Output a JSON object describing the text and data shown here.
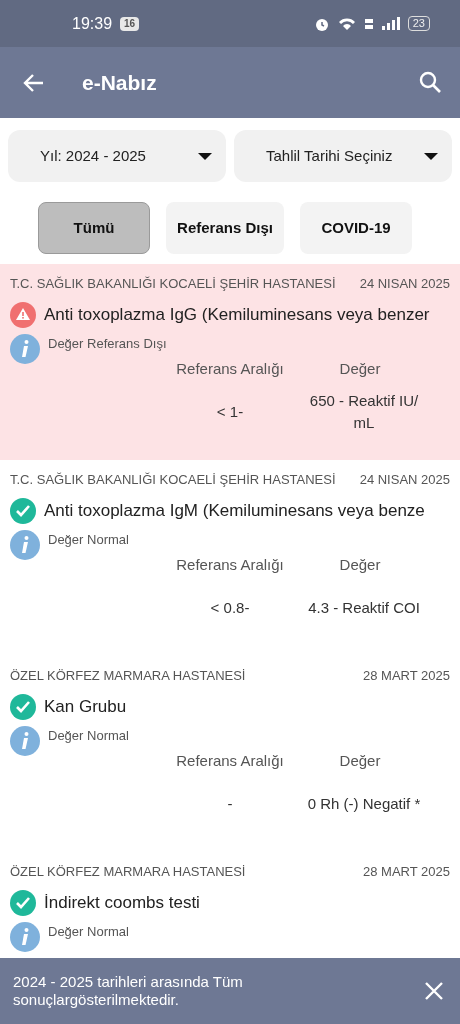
{
  "status_bar": {
    "time": "19:39",
    "notification_badge": "16",
    "battery": "23"
  },
  "app_bar": {
    "title": "e-Nabız"
  },
  "filters": [
    {
      "label": "Yıl: 2024 - 2025"
    },
    {
      "label": "Tahlil Tarihi Seçiniz"
    }
  ],
  "tabs": [
    {
      "label": "Tümü",
      "selected": true
    },
    {
      "label": "Referans Dışı",
      "selected": false
    },
    {
      "label": "COVID-19",
      "selected": false
    }
  ],
  "results": [
    {
      "hospital": "T.C. SAĞLIK BAKANLIĞI KOCAELİ ŞEHİR HASTANESİ",
      "date": "24 NISAN 2025",
      "out_of_range": true,
      "test": "Anti toxoplazma IgG (Kemiluminesans veya benzer",
      "note": "Değer Referans Dışı",
      "ref_header": "Referans Aralığı",
      "value_header": "Değer",
      "ref": "< 1-",
      "value": "650 - Reaktif IU/ mL"
    },
    {
      "hospital": "T.C. SAĞLIK BAKANLIĞI KOCAELİ ŞEHİR HASTANESİ",
      "date": "24 NISAN 2025",
      "out_of_range": false,
      "test": "Anti toxoplazma IgM (Kemiluminesans veya benze",
      "note": "Değer Normal",
      "ref_header": "Referans Aralığı",
      "value_header": "Değer",
      "ref": "< 0.8-",
      "value": "4.3 - Reaktif COI"
    },
    {
      "hospital": "ÖZEL KÖRFEZ MARMARA HASTANESİ",
      "date": "28 MART 2025",
      "out_of_range": false,
      "test": "Kan Grubu",
      "note": "Değer Normal",
      "ref_header": "Referans Aralığı",
      "value_header": "Değer",
      "ref": "-",
      "value": "0 Rh (-) Negatif *"
    },
    {
      "hospital": "ÖZEL KÖRFEZ MARMARA HASTANESİ",
      "date": "28 MART 2025",
      "out_of_range": false,
      "test": "İndirekt coombs testi",
      "note": "Değer Normal"
    }
  ],
  "snackbar": {
    "message": "2024 - 2025 tarihleri arasında Tüm sonuçlargösterilmektedir."
  }
}
